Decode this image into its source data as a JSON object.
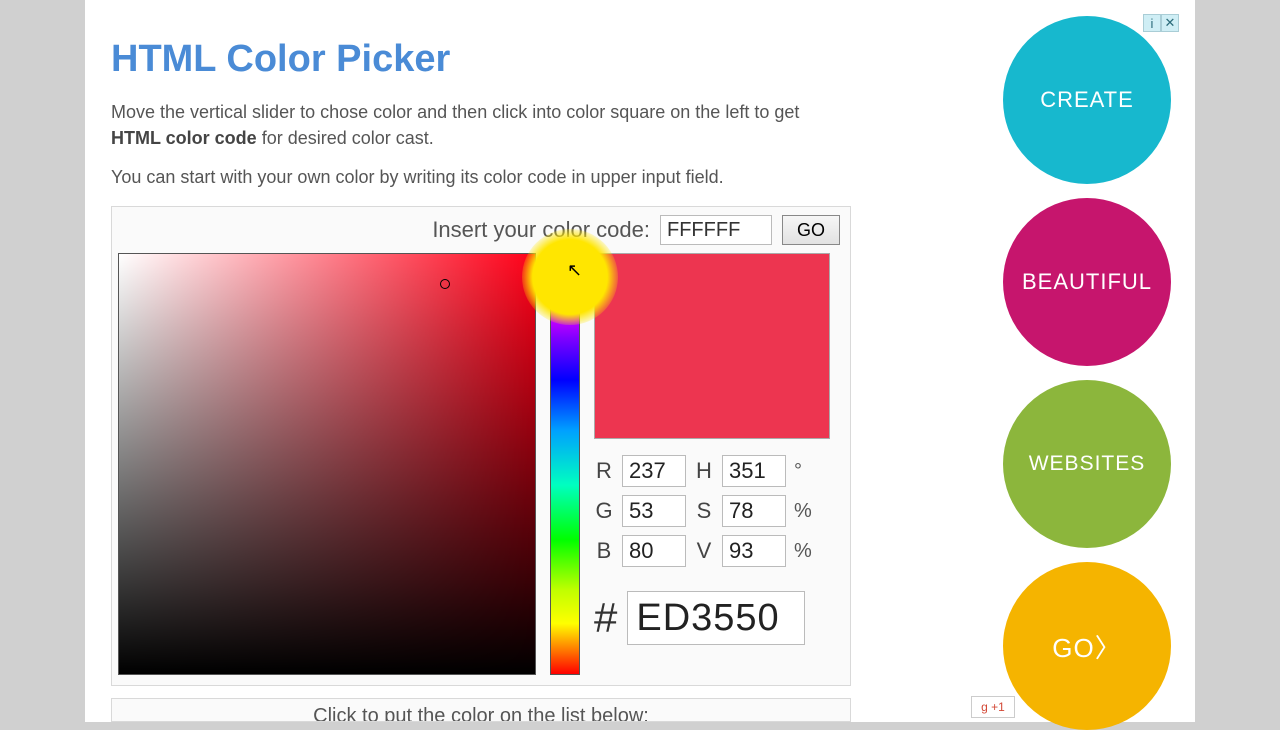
{
  "title": "HTML Color Picker",
  "intro": {
    "before_bold": "Move the vertical slider to chose color and then click into color square on the left to get ",
    "bold": "HTML color code",
    "after_bold": " for desired color cast."
  },
  "intro2": "You can start with your own color by writing its color code in upper input field.",
  "insert": {
    "label": "Insert your color code:",
    "value": "FFFFFF",
    "go": "GO"
  },
  "swatch_color": "#ED3550",
  "rgb": {
    "r_label": "R",
    "r": "237",
    "g_label": "G",
    "g": "53",
    "b_label": "B",
    "b": "80"
  },
  "hsv": {
    "h_label": "H",
    "h": "351",
    "h_unit": "°",
    "s_label": "S",
    "s": "78",
    "s_unit": "%",
    "v_label": "V",
    "v": "93",
    "v_unit": "%"
  },
  "hex": {
    "hash": "#",
    "value": "ED3550"
  },
  "footer_hint": "Click to put the color on the list below:",
  "ads": {
    "items": [
      "CREATE",
      "BEAUTIFUL",
      "WEBSITES",
      "GO〉"
    ],
    "close_info": "i",
    "close_x": "✕"
  },
  "gplus": "g +1"
}
